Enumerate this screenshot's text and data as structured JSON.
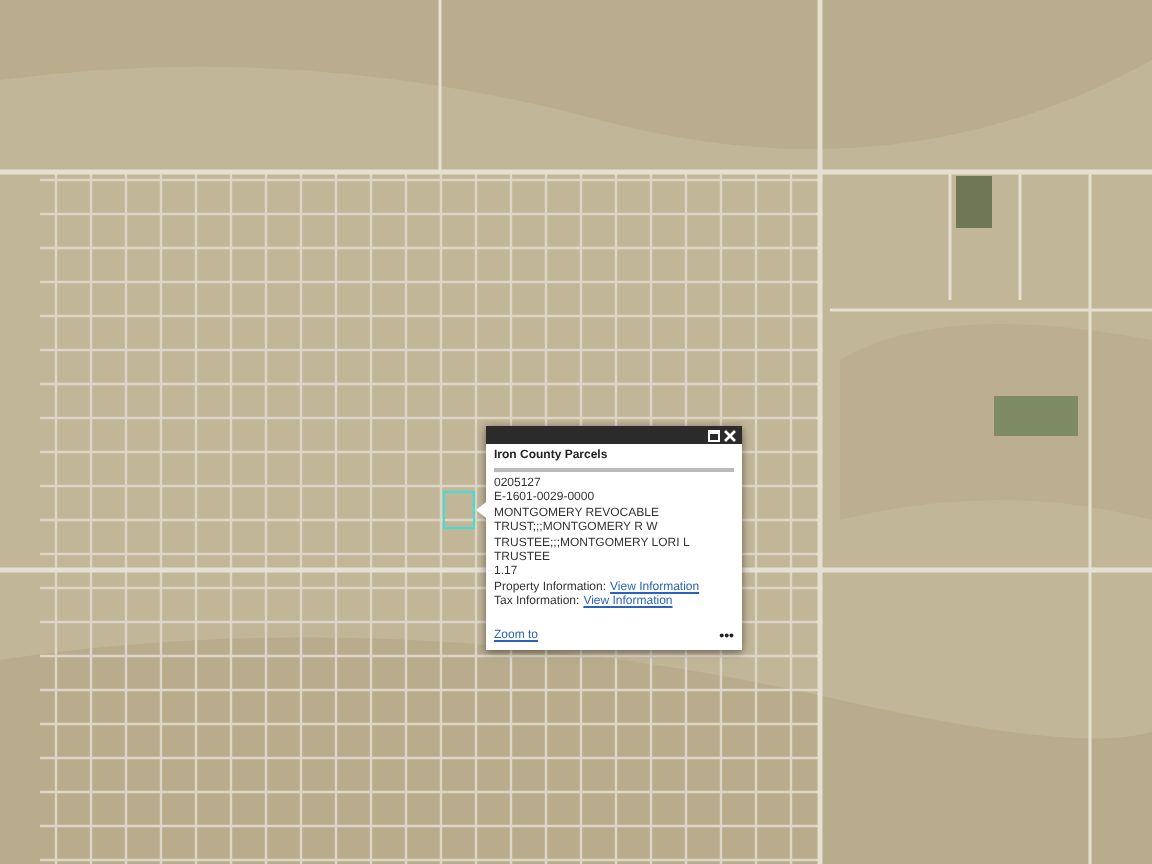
{
  "popup": {
    "title": "Iron County Parcels",
    "lines": [
      "0205127",
      "E-1601-0029-0000",
      "MONTGOMERY REVOCABLE TRUST;;;MONTGOMERY R W TRUSTEE;;;MONTGOMERY LORI L TRUSTEE",
      "1.17"
    ],
    "info_rows": [
      {
        "label": "Property Information:",
        "link": "View Information"
      },
      {
        "label": "Tax Information:",
        "link": "View Information"
      }
    ],
    "zoom_link": "Zoom to",
    "more": "•••"
  }
}
